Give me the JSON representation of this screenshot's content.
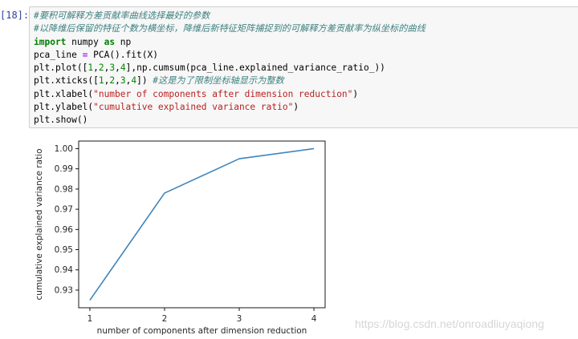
{
  "cell": {
    "prompt": "[18]:",
    "lines": [
      [
        {
          "t": "#要积可解释方差贡献率曲线选择最好的参数",
          "c": "cm"
        }
      ],
      [
        {
          "t": "#以降维后保留的特征个数为横坐标，降维后新特征矩阵捕捉到的可解释方差贡献率为纵坐标的曲线",
          "c": "cm"
        }
      ],
      [
        {
          "t": "import",
          "c": "kw"
        },
        {
          "t": " numpy ",
          "c": ""
        },
        {
          "t": "as",
          "c": "kw"
        },
        {
          "t": " np",
          "c": ""
        }
      ],
      [
        {
          "t": "pca_line ",
          "c": ""
        },
        {
          "t": "=",
          "c": "op"
        },
        {
          "t": " PCA().fit(X)",
          "c": ""
        }
      ],
      [
        {
          "t": "plt.plot([",
          "c": ""
        },
        {
          "t": "1",
          "c": "num"
        },
        {
          "t": ",",
          "c": ""
        },
        {
          "t": "2",
          "c": "num"
        },
        {
          "t": ",",
          "c": ""
        },
        {
          "t": "3",
          "c": "num"
        },
        {
          "t": ",",
          "c": ""
        },
        {
          "t": "4",
          "c": "num"
        },
        {
          "t": "],np.cumsum(pca_line.explained_variance_ratio_))",
          "c": ""
        }
      ],
      [
        {
          "t": "plt.xticks([",
          "c": ""
        },
        {
          "t": "1",
          "c": "num"
        },
        {
          "t": ",",
          "c": ""
        },
        {
          "t": "2",
          "c": "num"
        },
        {
          "t": ",",
          "c": ""
        },
        {
          "t": "3",
          "c": "num"
        },
        {
          "t": ",",
          "c": ""
        },
        {
          "t": "4",
          "c": "num"
        },
        {
          "t": "]) ",
          "c": ""
        },
        {
          "t": "#这是为了限制坐标轴显示为整数",
          "c": "cm"
        }
      ],
      [
        {
          "t": "plt.xlabel(",
          "c": ""
        },
        {
          "t": "\"number of components after dimension reduction\"",
          "c": "str"
        },
        {
          "t": ")",
          "c": ""
        }
      ],
      [
        {
          "t": "plt.ylabel(",
          "c": ""
        },
        {
          "t": "\"cumulative explained variance ratio\"",
          "c": "str"
        },
        {
          "t": ")",
          "c": ""
        }
      ],
      [
        {
          "t": "plt.show()",
          "c": ""
        }
      ]
    ]
  },
  "chart_data": {
    "type": "line",
    "x": [
      1,
      2,
      3,
      4
    ],
    "series": [
      {
        "values": [
          0.925,
          0.978,
          0.995,
          1.0
        ],
        "color": "#3f85bc"
      }
    ],
    "xticks": [
      "1",
      "2",
      "3",
      "4"
    ],
    "yticks": [
      "0.93",
      "0.94",
      "0.95",
      "0.96",
      "0.97",
      "0.98",
      "0.99",
      "1.00"
    ],
    "xlabel": "number of components after dimension reduction",
    "ylabel": "cumulative explained variance ratio",
    "xlim": [
      0.85,
      4.15
    ],
    "ylim": [
      0.92125,
      1.00375
    ],
    "grid": false
  },
  "watermark": "https://blog.csdn.net/onroadliuyaqiong"
}
